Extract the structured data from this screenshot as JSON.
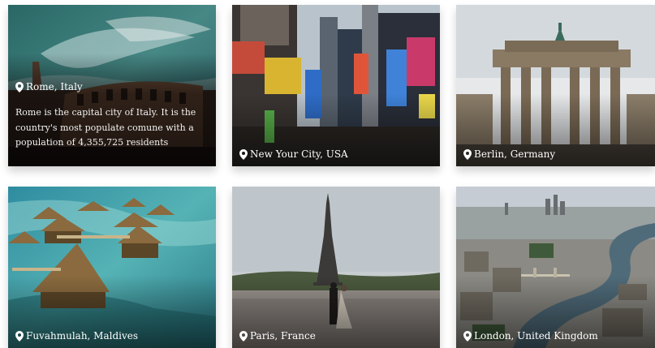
{
  "cards": [
    {
      "location": "Rome, Italy",
      "description": "Rome is the capital city of Italy. It is the country's most populate comune with a population of 4,355,725 residents"
    },
    {
      "location": "New Your City, USA"
    },
    {
      "location": "Berlin, Germany"
    },
    {
      "location": "Fuvahmulah, Maldives"
    },
    {
      "location": "Paris, France"
    },
    {
      "location": "London, United Kingdom"
    }
  ],
  "icons": {
    "pin": "map-pin-icon"
  },
  "colors": {
    "caption_text": "#ffffff",
    "page_background": "#ffffff"
  }
}
